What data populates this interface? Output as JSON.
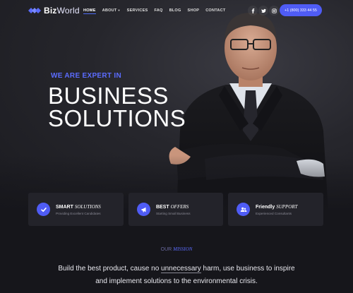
{
  "header": {
    "logo_bold": "Biz",
    "logo_light": "World",
    "nav": [
      "HOME",
      "ABOUT",
      "SERVICES",
      "FAQ",
      "BLOG",
      "SHOP",
      "CONTACT"
    ],
    "phone": "+1 (800) 333 44 55"
  },
  "hero": {
    "tagline": "WE ARE EXPERT IN",
    "headline_line1": "BUSINESS",
    "headline_line2": "SOLUTIONS"
  },
  "cards": [
    {
      "title_bold": "SMART",
      "title_italic": "SOLUTIONS",
      "subtitle": "Providing Excellent Candidates",
      "icon": "check-icon"
    },
    {
      "title_bold": "BEST",
      "title_italic": "OFFERS",
      "subtitle": "Starting Small Business",
      "icon": "megaphone-icon"
    },
    {
      "title_bold": "Friendly",
      "title_italic": "SUPPORT",
      "subtitle": "Experienced Consultants",
      "icon": "users-icon"
    }
  ],
  "mission": {
    "label_our": "OUR",
    "label_italic": "MISSION",
    "text_before": "Build the best product, cause no",
    "text_underlined": "unnecessary",
    "text_after": "harm, use business to inspire",
    "text_line2": "and implement solutions to the environmental crisis."
  },
  "colors": {
    "accent": "#4f5cf5",
    "background": "#16161b",
    "card": "#23232a"
  }
}
